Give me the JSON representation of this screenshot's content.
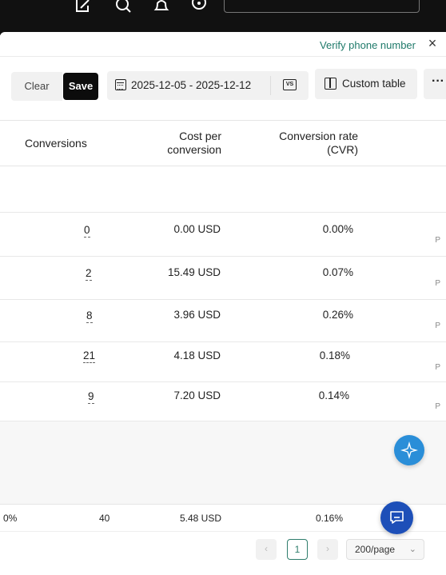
{
  "topbar": {
    "icons": [
      "edit-icon",
      "search-icon",
      "bell-icon",
      "help-icon"
    ]
  },
  "notice": {
    "verify_text": "Verify phone number",
    "close_label": "×"
  },
  "toolbar": {
    "clear_label": "Clear",
    "save_label": "Save",
    "date_range": "2025-12-05 - 2025-12-12",
    "compare_label": "VS",
    "custom_table_label": "Custom table",
    "more_label": "···"
  },
  "table": {
    "headers": {
      "conversions": "Conversions",
      "cost_per_conversion_1": "Cost per",
      "cost_per_conversion_2": "conversion",
      "cvr_1": "Conversion rate",
      "cvr_2": "(CVR)"
    },
    "rows": [
      {
        "conversions": "0",
        "cost": "0.00 USD",
        "cvr": "0.00%",
        "edge": "P"
      },
      {
        "conversions": "2",
        "cost": "15.49 USD",
        "cvr": "0.07%",
        "edge": "P"
      },
      {
        "conversions": "8",
        "cost": "3.96 USD",
        "cvr": "0.26%",
        "edge": "P"
      },
      {
        "conversions": "21",
        "cost": "4.18 USD",
        "cvr": "0.18%",
        "edge": "P"
      },
      {
        "conversions": "9",
        "cost": "7.20 USD",
        "cvr": "0.14%",
        "edge": "P"
      }
    ],
    "total": {
      "left": "0%",
      "conversions": "40",
      "cost": "5.48 USD",
      "cvr": "0.16%"
    }
  },
  "pagination": {
    "prev": "‹",
    "current_page": "1",
    "next": "›",
    "page_size": "200/page",
    "chevron": "⌄"
  },
  "colors": {
    "accent": "#2f7d6c",
    "save_bg": "#0c0c0c",
    "chat_fab": "#1d4fb8",
    "assistant_fab": "#2a8ed8"
  }
}
